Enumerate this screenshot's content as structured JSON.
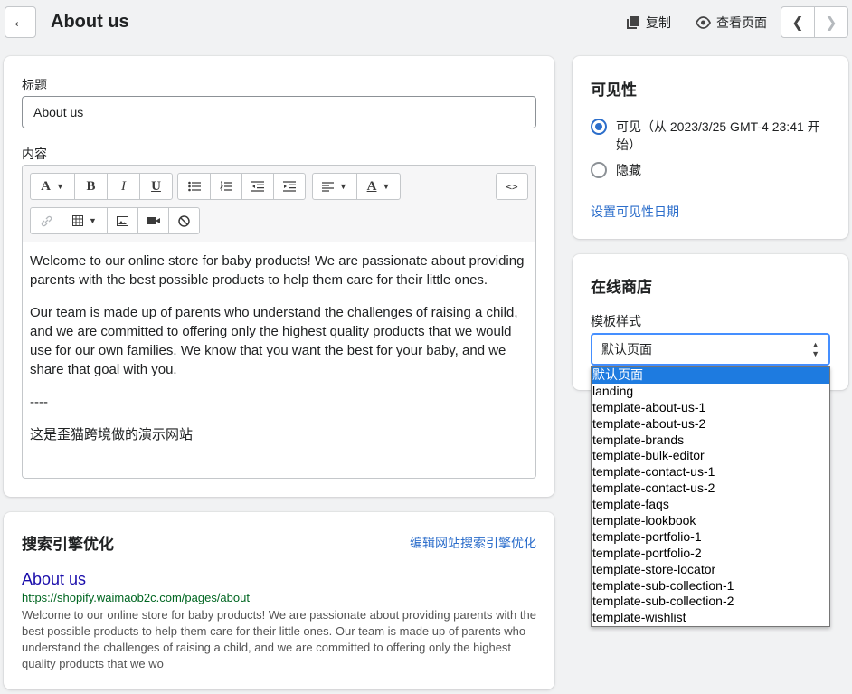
{
  "header": {
    "title": "About us",
    "duplicate_label": "复制",
    "view_label": "查看页面"
  },
  "page": {
    "title_label": "标题",
    "title_value": "About us",
    "content_label": "内容",
    "content": {
      "p1": "Welcome to our online store for baby products! We are passionate about providing parents with the best possible products to help them care for their little ones.",
      "p2": "Our team is made up of parents who understand the challenges of raising a child, and we are committed to offering only the highest quality products that we would use for our own families. We know that you want the best for your baby, and we share that goal with you.",
      "p3": "----",
      "p4": "这是歪猫跨境做的演示网站"
    }
  },
  "toolbar": {
    "font_glyph": "A",
    "bold_glyph": "B",
    "italic_glyph": "I",
    "underline_glyph": "U",
    "color_glyph": "A",
    "code_glyph": "<>"
  },
  "seo": {
    "title": "搜索引擎优化",
    "edit_link": "编辑网站搜索引擎优化",
    "preview_title": "About us",
    "preview_url": "https://shopify.waimaob2c.com/pages/about",
    "preview_desc": "Welcome to our online store for baby products! We are passionate about providing parents with the best possible products to help them care for their little ones. Our team is made up of parents who understand the challenges of raising a child, and we are committed to offering only the highest quality products that we wo"
  },
  "visibility": {
    "title": "可见性",
    "visible_label": "可见（从 2023/3/25 GMT-4 23:41 开始）",
    "hidden_label": "隐藏",
    "set_date_link": "设置可见性日期",
    "selected": "visible"
  },
  "store": {
    "title": "在线商店",
    "template_label": "模板样式",
    "selected_template": "默认页面",
    "templates": [
      "默认页面",
      "landing",
      "template-about-us-1",
      "template-about-us-2",
      "template-brands",
      "template-bulk-editor",
      "template-contact-us-1",
      "template-contact-us-2",
      "template-faqs",
      "template-lookbook",
      "template-portfolio-1",
      "template-portfolio-2",
      "template-store-locator",
      "template-sub-collection-1",
      "template-sub-collection-2",
      "template-wishlist"
    ]
  },
  "colors": {
    "accent": "#2c6ecb",
    "dropdown_highlight": "#1e7be0",
    "seo_link": "#1a0dab",
    "seo_url": "#006621"
  }
}
